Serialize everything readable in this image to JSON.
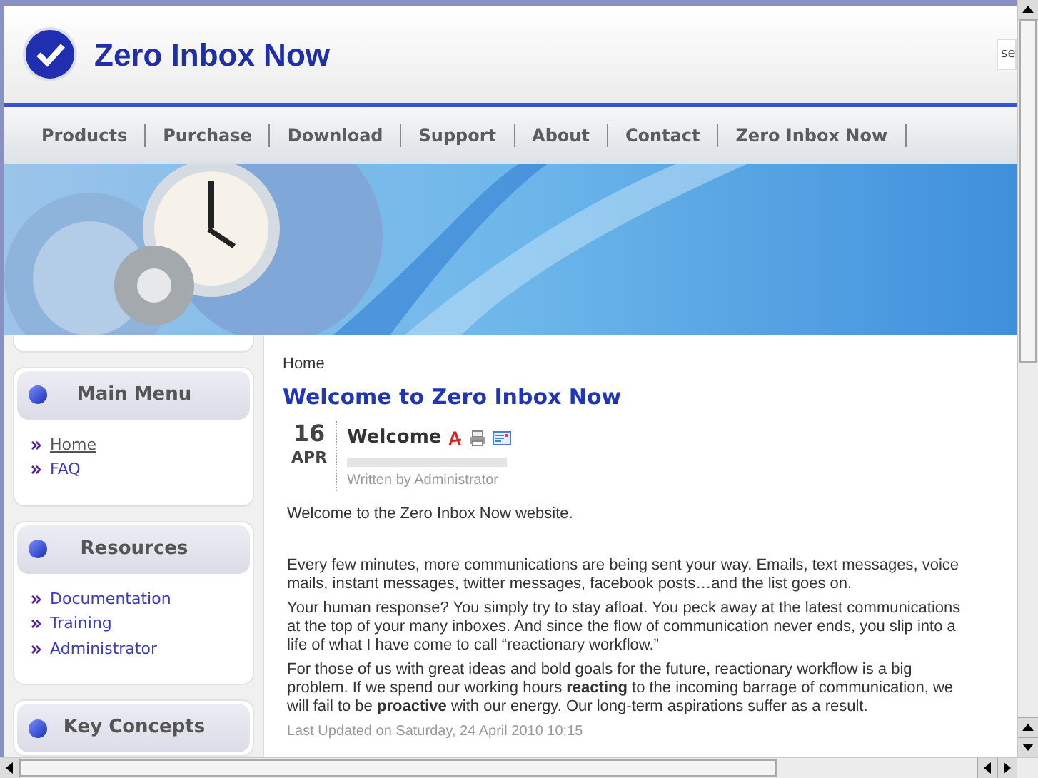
{
  "site": {
    "title": "Zero Inbox Now",
    "search": {
      "value": "se"
    }
  },
  "nav": [
    {
      "label": "Products"
    },
    {
      "label": "Purchase"
    },
    {
      "label": "Download"
    },
    {
      "label": "Support"
    },
    {
      "label": "About"
    },
    {
      "label": "Contact"
    },
    {
      "label": "Zero Inbox Now"
    }
  ],
  "sidebar": {
    "modules": [
      {
        "title": "Main Menu",
        "items": [
          {
            "label": "Home",
            "selected": true
          },
          {
            "label": "FAQ",
            "selected": false
          }
        ]
      },
      {
        "title": "Resources",
        "items": [
          {
            "label": "Documentation",
            "selected": false
          },
          {
            "label": "Training",
            "selected": false
          },
          {
            "label": "Administrator",
            "selected": false
          }
        ]
      },
      {
        "title": "Key Concepts"
      }
    ]
  },
  "content": {
    "breadcrumb": "Home",
    "heading": "Welcome to Zero Inbox Now",
    "article": {
      "day": "16",
      "month": "APR",
      "title": "Welcome",
      "byline": "Written by Administrator",
      "paragraphs": [
        "Welcome to the Zero Inbox Now website.",
        "Every few minutes, more communications are being sent your way. Emails, text messages, voice mails, instant messages, twitter messages, facebook posts…and the list goes on.",
        "Your human response? You simply try to stay afloat. You peck away at the latest communications at the top of your many inboxes. And since the flow of communication never ends, you slip into a life of what I have come to call “reactionary workflow.”",
        "For those of us with great ideas and bold goals for the future, reactionary workflow is a big problem. If we spend our working hours **reacting** to the incoming barrage of communication, we will fail to be **proactive** with our energy. Our long-term aspirations suffer as a result."
      ],
      "updated": "Last Updated on Saturday, 24 April 2010 10:15"
    }
  }
}
